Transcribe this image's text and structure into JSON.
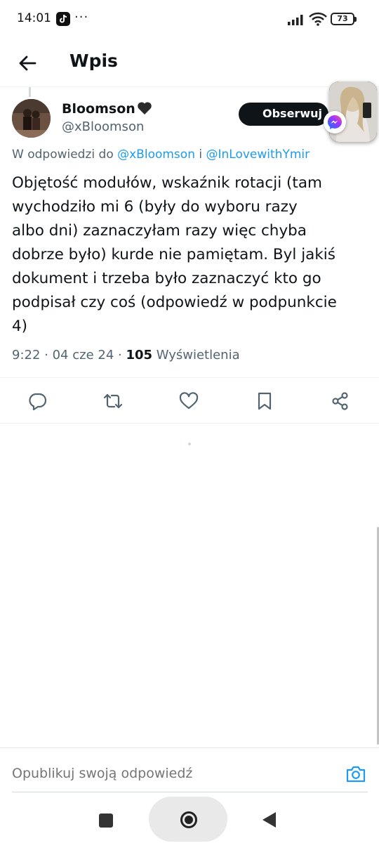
{
  "status_bar": {
    "time": "14:01",
    "more": "···",
    "battery": "73"
  },
  "header": {
    "title": "Wpis"
  },
  "tweet": {
    "author_name": "Bloomson",
    "author_handle": "@xBloomson",
    "follow_label": "Obserwuj",
    "reply_prefix": "W odpowiedzi do ",
    "reply_mention_1": "@xBloomson",
    "reply_joiner": " i ",
    "reply_mention_2": "@InLovewithYmir",
    "text_lines": [
      "Objętość modułów, wskaźnik rotacji (tam",
      "wychodziło mi 6 (były do wyboru razy",
      "albo dni) zaznaczyłam razy więc chyba",
      "dobrze było) kurde nie pamiętam. Byl jakiś",
      "dokument i trzeba było zaznaczyć kto go",
      "podpisał czy coś (odpowiedź w podpunkcie",
      "4)"
    ],
    "time": "9:22",
    "separator": " · ",
    "date": "04 cze 24",
    "views_count": "105",
    "views_label": " Wyświetlenia"
  },
  "actions": [
    {
      "name": "reply-icon"
    },
    {
      "name": "retweet-icon"
    },
    {
      "name": "like-icon"
    },
    {
      "name": "bookmark-icon"
    },
    {
      "name": "share-icon"
    }
  ],
  "reply_bar": {
    "placeholder": "Opublikuj swoją odpowiedź"
  },
  "colors": {
    "accent": "#1d9bf0",
    "text": "#0f1419",
    "secondary": "#536471"
  }
}
